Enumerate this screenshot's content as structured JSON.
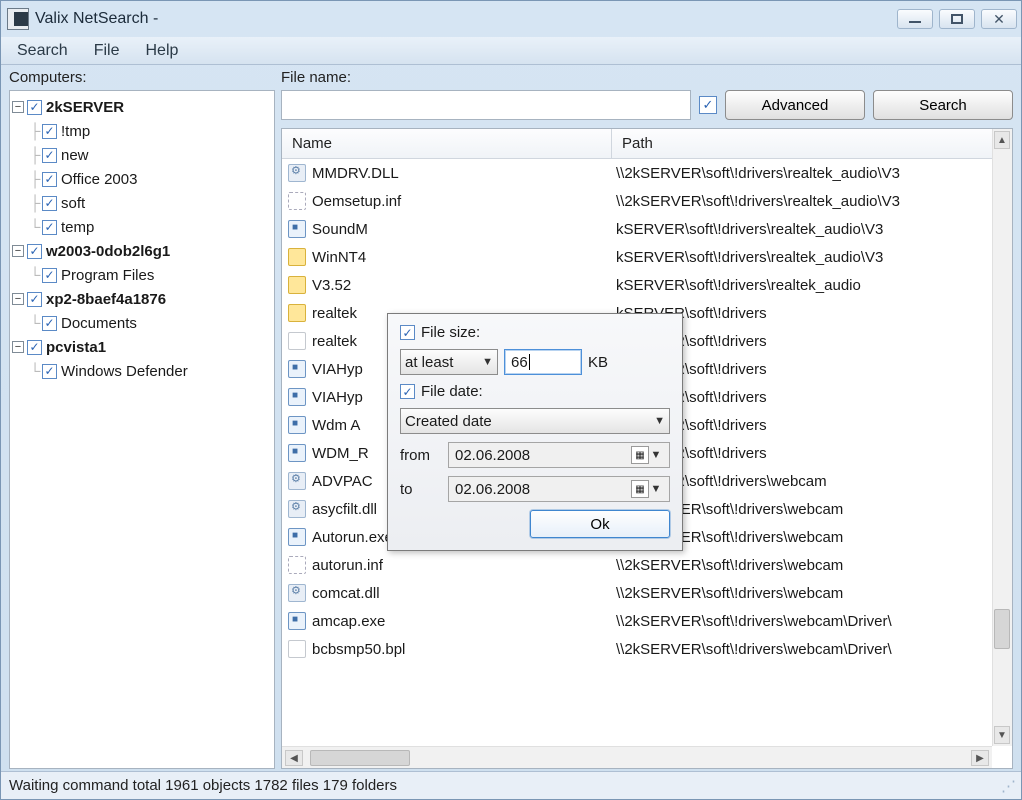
{
  "window": {
    "title": "Valix NetSearch -"
  },
  "menu": {
    "search": "Search",
    "file": "File",
    "help": "Help"
  },
  "labels": {
    "computers": "Computers:",
    "filename": "File name:"
  },
  "buttons": {
    "advanced": "Advanced",
    "search": "Search"
  },
  "tree": [
    {
      "label": "2kSERVER",
      "expanded": true,
      "children": [
        {
          "label": "!tmp"
        },
        {
          "label": "new"
        },
        {
          "label": "Office 2003"
        },
        {
          "label": "soft"
        },
        {
          "label": "temp"
        }
      ]
    },
    {
      "label": "w2003-0dob2l6g1",
      "expanded": true,
      "children": [
        {
          "label": "Program Files"
        }
      ]
    },
    {
      "label": "xp2-8baef4a1876",
      "expanded": true,
      "children": [
        {
          "label": "Documents"
        }
      ]
    },
    {
      "label": "pcvista1",
      "expanded": true,
      "children": [
        {
          "label": "Windows Defender"
        }
      ]
    }
  ],
  "results": {
    "columns": {
      "name": "Name",
      "path": "Path"
    },
    "rows": [
      {
        "icon": "dll",
        "name": "MMDRV.DLL",
        "path": "\\\\2kSERVER\\soft\\!drivers\\realtek_audio\\V3"
      },
      {
        "icon": "inf",
        "name": "Oemsetup.inf",
        "path": "\\\\2kSERVER\\soft\\!drivers\\realtek_audio\\V3"
      },
      {
        "icon": "exe",
        "name": "SoundM",
        "path": "kSERVER\\soft\\!drivers\\realtek_audio\\V3"
      },
      {
        "icon": "folder",
        "name": "WinNT4",
        "path": "kSERVER\\soft\\!drivers\\realtek_audio\\V3"
      },
      {
        "icon": "folder",
        "name": "V3.52",
        "path": "kSERVER\\soft\\!drivers\\realtek_audio"
      },
      {
        "icon": "folder",
        "name": "realtek",
        "path": "kSERVER\\soft\\!drivers"
      },
      {
        "icon": "file",
        "name": "realtek",
        "path": "kSERVER\\soft\\!drivers"
      },
      {
        "icon": "exe",
        "name": "VIAHyp",
        "path": "kSERVER\\soft\\!drivers"
      },
      {
        "icon": "exe",
        "name": "VIAHyp",
        "path": "kSERVER\\soft\\!drivers"
      },
      {
        "icon": "exe",
        "name": "Wdm A",
        "path": "kSERVER\\soft\\!drivers"
      },
      {
        "icon": "exe",
        "name": "WDM_R",
        "path": "kSERVER\\soft\\!drivers"
      },
      {
        "icon": "dll",
        "name": "ADVPAC",
        "path": "kSERVER\\soft\\!drivers\\webcam"
      },
      {
        "icon": "dll",
        "name": "asycfilt.dll",
        "path": "\\\\2kSERVER\\soft\\!drivers\\webcam"
      },
      {
        "icon": "exe",
        "name": "Autorun.exe",
        "path": "\\\\2kSERVER\\soft\\!drivers\\webcam"
      },
      {
        "icon": "inf",
        "name": "autorun.inf",
        "path": "\\\\2kSERVER\\soft\\!drivers\\webcam"
      },
      {
        "icon": "dll",
        "name": "comcat.dll",
        "path": "\\\\2kSERVER\\soft\\!drivers\\webcam"
      },
      {
        "icon": "exe",
        "name": "amcap.exe",
        "path": "\\\\2kSERVER\\soft\\!drivers\\webcam\\Driver\\"
      },
      {
        "icon": "file",
        "name": "bcbsmp50.bpl",
        "path": "\\\\2kSERVER\\soft\\!drivers\\webcam\\Driver\\"
      }
    ]
  },
  "dialog": {
    "filesize_label": "File size:",
    "filesize_mode": "at least",
    "filesize_value": "66",
    "filesize_unit": "KB",
    "filedate_label": "File date:",
    "filedate_mode": "Created date",
    "from_label": "from",
    "to_label": "to",
    "from_value": "02.06.2008",
    "to_value": "02.06.2008",
    "ok": "Ok"
  },
  "status": "Waiting command  total 1961 objects 1782 files 179 folders"
}
